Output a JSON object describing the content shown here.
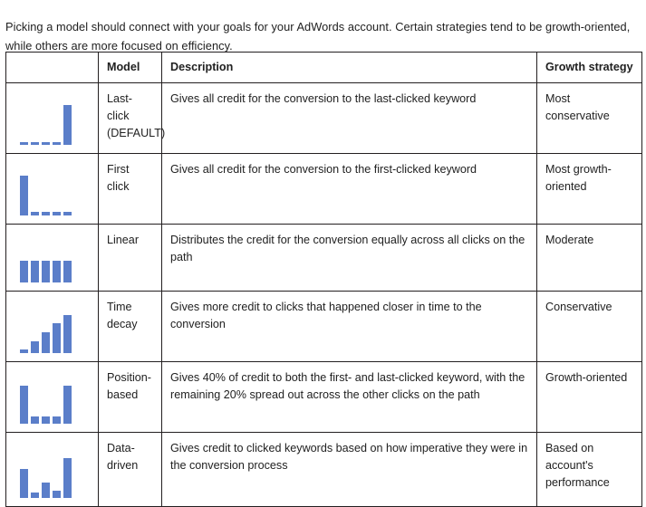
{
  "intro": {
    "paragraph": "Picking a model should connect with your goals for your AdWords account. Certain strategies tend to be growth-oriented, while others are more focused on efficiency."
  },
  "table": {
    "headers": {
      "icon": "",
      "model": "Model",
      "description": "Description",
      "growth": "Growth strategy"
    },
    "accent_color": "#5b7ec9",
    "border_color": "#231f20",
    "rows": [
      {
        "model": "Last-click (DEFAULT)",
        "description": "Gives all credit for the conversion to the last-clicked keyword",
        "growth": "Most conservative",
        "chart": {
          "type": "bar",
          "name": "last-click-distribution",
          "categories": [
            "1",
            "2",
            "3",
            "4",
            "5"
          ],
          "values": [
            5,
            5,
            5,
            5,
            100
          ],
          "ylim": [
            0,
            100
          ]
        }
      },
      {
        "model": "First click",
        "description": "Gives all credit for the conversion to the first-clicked keyword",
        "growth": "Most growth-oriented",
        "chart": {
          "type": "bar",
          "name": "first-click-distribution",
          "categories": [
            "1",
            "2",
            "3",
            "4",
            "5"
          ],
          "values": [
            100,
            8,
            8,
            8,
            8
          ],
          "ylim": [
            0,
            100
          ]
        }
      },
      {
        "model": "Linear",
        "description": "Distributes the credit for the conversion equally across all clicks on the path",
        "growth": "Moderate",
        "chart": {
          "type": "bar",
          "name": "linear-distribution",
          "categories": [
            "1",
            "2",
            "3",
            "4",
            "5"
          ],
          "values": [
            55,
            55,
            55,
            55,
            55
          ],
          "ylim": [
            0,
            100
          ]
        }
      },
      {
        "model": "Time decay",
        "description": "Gives more credit to clicks that happened closer in time to the conversion",
        "growth": "Conservative",
        "chart": {
          "type": "bar",
          "name": "time-decay-distribution",
          "categories": [
            "1",
            "2",
            "3",
            "4",
            "5"
          ],
          "values": [
            10,
            30,
            52,
            74,
            95
          ],
          "ylim": [
            0,
            100
          ]
        }
      },
      {
        "model": "Position-based",
        "description": "Gives 40% of credit to both the first- and last-clicked keyword, with the remaining 20% spread out across the other clicks on the path",
        "growth": "Growth-oriented",
        "chart": {
          "type": "bar",
          "name": "position-based-distribution",
          "categories": [
            "1",
            "2",
            "3",
            "4",
            "5"
          ],
          "values": [
            95,
            18,
            18,
            18,
            95
          ],
          "ylim": [
            0,
            100
          ]
        }
      },
      {
        "model": "Data-driven",
        "description": "Gives credit to clicked keywords based on how imperative they were in the conversion process",
        "growth": "Based on account's performance",
        "chart": {
          "type": "bar",
          "name": "data-driven-distribution",
          "categories": [
            "1",
            "2",
            "3",
            "4",
            "5"
          ],
          "values": [
            72,
            14,
            38,
            18,
            100
          ],
          "ylim": [
            0,
            100
          ]
        }
      }
    ]
  }
}
